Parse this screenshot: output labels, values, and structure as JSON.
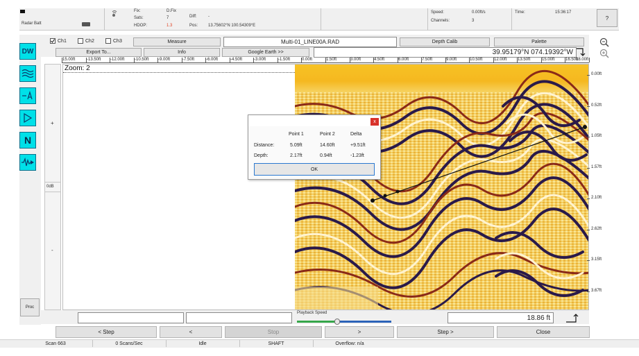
{
  "header": {
    "radar_batt_label": "Radar Batt",
    "fix_label": "Fix:",
    "fix_value": "D.Fix",
    "sats_label": "Sats:",
    "sats_value": "7",
    "hdop_label": "HDOP:",
    "hdop_value": "1.3",
    "diff_label": "Diff:",
    "diff_value": "-",
    "pos_label": "Pos:",
    "pos_value": "13.75602°N 100.54309°E",
    "speed_label": "Speed:",
    "speed_value": "0.00ft/s",
    "channels_label": "Channels:",
    "channels_value": "3",
    "time_label": "Time:",
    "time_value": "15:36:17",
    "help_label": "?"
  },
  "toolbar": {
    "ch1": "Ch1",
    "ch2": "Ch2",
    "ch3": "Ch3",
    "measure": "Measure",
    "filename": "Multi-01_LINE00A.RAD",
    "depth_calib": "Depth Calib",
    "palette": "Palette",
    "export": "Export To...",
    "info": "Info",
    "google_earth": "Google Earth >>",
    "coords": "39.95179°N 074.19392°W"
  },
  "ruler": [
    "15.00ft",
    "-13.50ft",
    "-12.00ft",
    "-10.50ft",
    "-9.00ft",
    "-7.50ft",
    "-6.00ft",
    "-4.50ft",
    "-3.00ft",
    "-1.50ft",
    "0.00ft",
    "1.50ft",
    "3.00ft",
    "4.50ft",
    "6.00ft",
    "7.50ft",
    "9.00ft",
    "10.50ft",
    "12.00ft",
    "13.50ft",
    "15.00ft",
    "16.50ft",
    "18.00ft"
  ],
  "zoom_label": "Zoom: 2",
  "depth_scale": [
    "0.00ft",
    "0.52ft",
    "1.05ft",
    "1.57ft",
    "2.10ft",
    "2.62ft",
    "3.15ft",
    "3.67ft"
  ],
  "gain": {
    "plus": "+",
    "zero": "0dB",
    "minus": "-"
  },
  "left_tools": {
    "dw": "DW",
    "n": "N",
    "proc": "Proc"
  },
  "dialog": {
    "close": "x",
    "col_point1": "Point 1",
    "col_point2": "Point 2",
    "col_delta": "Delta",
    "distance_label": "Distance:",
    "distance_p1": "5.09ft",
    "distance_p2": "14.60ft",
    "distance_delta": "+9.51ft",
    "depth_label": "Depth:",
    "depth_p1": "2.17ft",
    "depth_p2": "0.94ft",
    "depth_delta": "-1.23ft",
    "ok": "OK"
  },
  "bottom": {
    "playback_label": "Playback Speed",
    "distance_value": "18.86 ft",
    "step_back": "< Step",
    "back": "<",
    "stop": "Stop",
    "forward": ">",
    "step_forward": "Step >",
    "close": "Close"
  },
  "status": {
    "scan": "Scan 663",
    "scans_per_sec": "0 Scans/Sec",
    "state": "Idle",
    "mode": "SHAFT",
    "overflow": "Overflow: n/a"
  },
  "colors": {
    "accent_cyan": "#00e0e8",
    "hdop_warn": "#e04020",
    "radar_dark": "#2a1a4a",
    "radar_yellow": "#f5c020"
  }
}
